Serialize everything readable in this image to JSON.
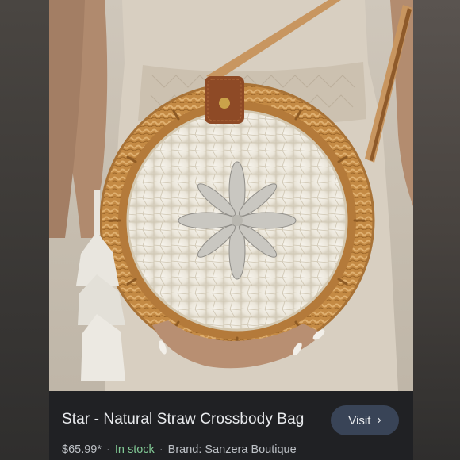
{
  "product": {
    "title": "Star - Natural Straw Crossbody Bag",
    "price": "$65.99*",
    "stock": "In stock",
    "brand": "Brand: Sanzera Boutique"
  },
  "visit_button": {
    "label": "Visit",
    "icon": "chevron-right-icon"
  },
  "separator": "·",
  "colors": {
    "info_bar_bg": "#202124",
    "button_bg": "#394457",
    "stock_green": "#81c995",
    "rattan": "#c8924a",
    "leather": "#8e4a26",
    "mother_of_pearl": "#eeeae0"
  }
}
